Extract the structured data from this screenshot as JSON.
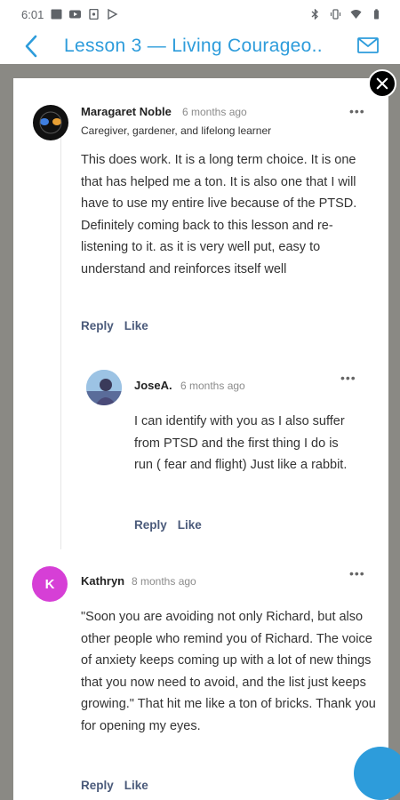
{
  "status_bar": {
    "time": "6:01"
  },
  "header": {
    "title": "Lesson 3 — Living Courageo.."
  },
  "comments": [
    {
      "author": "Maragaret Noble",
      "time": "6 months ago",
      "tagline": "Caregiver, gardener, and lifelong learner",
      "text": "This does work. It is a long term choice. It is one that has helped me a ton. It is also one that I will have to use my entire live because of the PTSD. Definitely coming back to this lesson and re-listening to it. as it is very well put, easy to understand and reinforces itself well",
      "reply_label": "Reply",
      "like_label": "Like"
    },
    {
      "author": "JoseA.",
      "time": "6 months ago",
      "text": "I can identify with you as I also suffer from PTSD and the first thing I do is run ( fear and flight) Just like a rabbit.",
      "reply_label": "Reply",
      "like_label": "Like"
    },
    {
      "author": "Kathryn",
      "avatar_letter": "K",
      "time": "8 months ago",
      "text": "\"Soon you are avoiding not only Richard, but also other people who remind you of Richard. The voice of anxiety keeps coming up with a lot of new things that you now need to avoid, and the list just keeps growing.\" That hit me like a ton of bricks. Thank you for opening my eyes.",
      "reply_label": "Reply",
      "like_label": "Like"
    }
  ],
  "more_label": "•••",
  "colors": {
    "accent": "#2d9cdb",
    "avatar_k": "#d63fd6",
    "action": "#4a5a7a"
  }
}
